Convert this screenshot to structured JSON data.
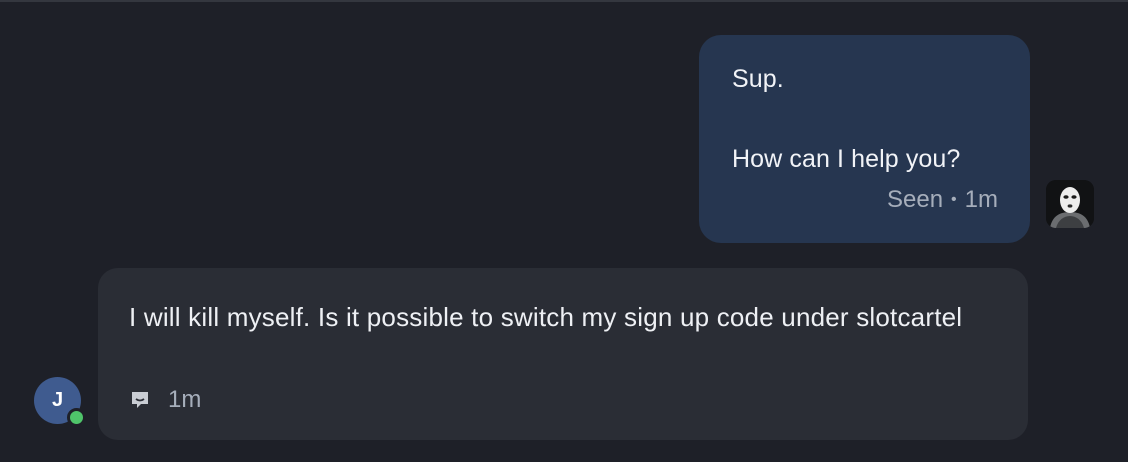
{
  "outgoing_message": {
    "line1": "Sup.",
    "line2": "How can I help you?",
    "status": "Seen",
    "separator": "•",
    "time": "1m"
  },
  "incoming_message": {
    "text": "I will kill myself. Is it possible to switch my sign up code under slotcartel",
    "time": "1m"
  },
  "user_avatar": {
    "initial": "J",
    "online": true
  },
  "icons": {
    "bot_avatar": "masked-figure-avatar",
    "message_type": "chat-bubble-icon"
  },
  "colors": {
    "background": "#1e2028",
    "outgoing_bubble": "#263650",
    "incoming_bubble": "#2a2d35",
    "user_avatar": "#3f5b8f",
    "online_indicator": "#4fc46a"
  }
}
